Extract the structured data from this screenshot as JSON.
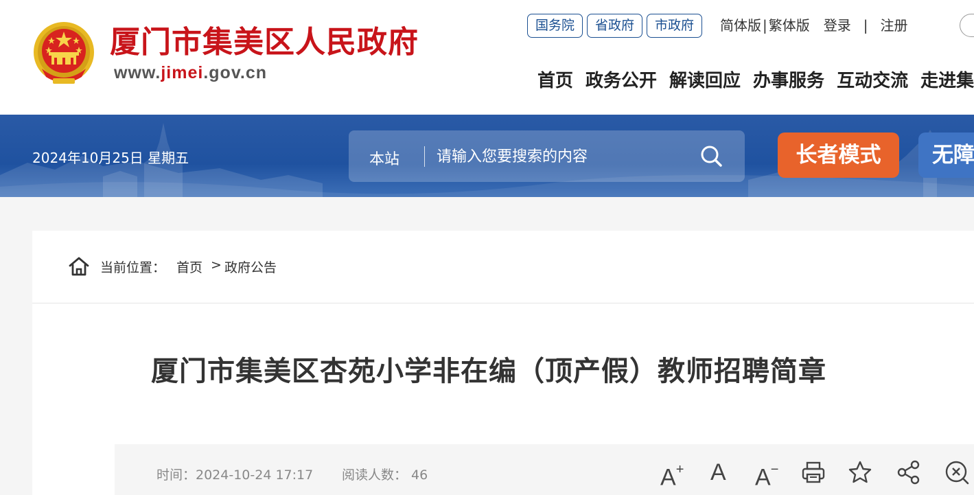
{
  "header": {
    "site_name": "厦门市集美区人民政府",
    "url_prefix": "www.",
    "url_highlight": "jimei",
    "url_suffix": ".gov.cn",
    "gov_links": [
      "国务院",
      "省政府",
      "市政府"
    ],
    "lang_simplified": "简体版",
    "lang_divider": "|",
    "lang_traditional": "繁体版",
    "login": "登录",
    "auth_divider": "|",
    "register": "注册",
    "nav": [
      "首页",
      "政务公开",
      "解读回应",
      "办事服务",
      "互动交流",
      "走进集美"
    ]
  },
  "banner": {
    "date": "2024年10月25日 星期五",
    "search_scope": "本站",
    "search_placeholder": "请输入您要搜索的内容",
    "elder_mode": "长者模式",
    "accessibility": "无障碍"
  },
  "breadcrumb": {
    "label": "当前位置：",
    "home": "首页",
    "separator": ">",
    "current": "政府公告"
  },
  "article": {
    "title": "厦门市集美区杏苑小学非在编（顶产假）教师招聘简章",
    "time": "时间：2024-10-24 17:17",
    "views": "阅读人数： 46"
  },
  "tools": {
    "font_large": "A",
    "font_large_mark": "+",
    "font_normal": "A",
    "font_small": "A",
    "font_small_mark": "−",
    "icons": [
      "print-icon",
      "star-icon",
      "share-icon",
      "close-icon"
    ]
  },
  "colors": {
    "brand_red": "#c8141a",
    "banner_blue": "#1f52a0",
    "elder_orange": "#e8632b",
    "link_blue": "#1a4f91"
  }
}
